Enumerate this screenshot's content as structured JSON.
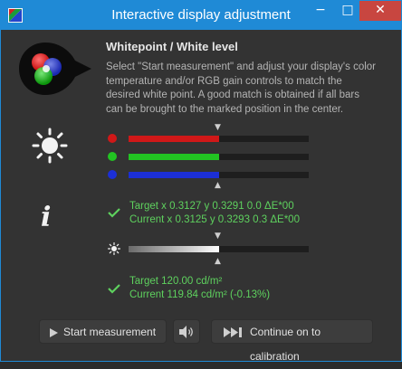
{
  "window": {
    "title": "Interactive display adjustment"
  },
  "titlebar_buttons": {
    "minimize": "−",
    "maximize": "□",
    "close": "✕"
  },
  "heading": "Whitepoint / White level",
  "description": "Select \"Start measurement\" and adjust your display's color temperature and/or RGB gain controls to match the desired white point. A good match is obtained if all bars can be brought to the marked position in the center.",
  "rgb_bars": [
    {
      "name": "red",
      "color": "#d01818",
      "level": 0.5
    },
    {
      "name": "green",
      "color": "#22c422",
      "level": 0.5
    },
    {
      "name": "blue",
      "color": "#1c2fd6",
      "level": 0.5
    }
  ],
  "whitepoint": {
    "target": "Target x 0.3127 y 0.3291 0.0 ΔE*00",
    "current": "Current x 0.3125 y 0.3293 0.3 ΔE*00"
  },
  "luminance_bar": {
    "level": 0.5
  },
  "white_level": {
    "target": "Target 120.00 cd/m²",
    "current": "Current 119.84 cd/m² (-0.13%)"
  },
  "buttons": {
    "start": "Start measurement",
    "continue": "Continue on to calibration"
  },
  "icons": [
    "app-icon",
    "rgb-logo-icon",
    "sun-icon",
    "info-icon",
    "check-icon",
    "sound-icon",
    "play-icon",
    "skip-forward-icon"
  ],
  "colors": {
    "accent": "#1f8ad6",
    "ok_text": "#5ed15e",
    "background": "#333333"
  }
}
